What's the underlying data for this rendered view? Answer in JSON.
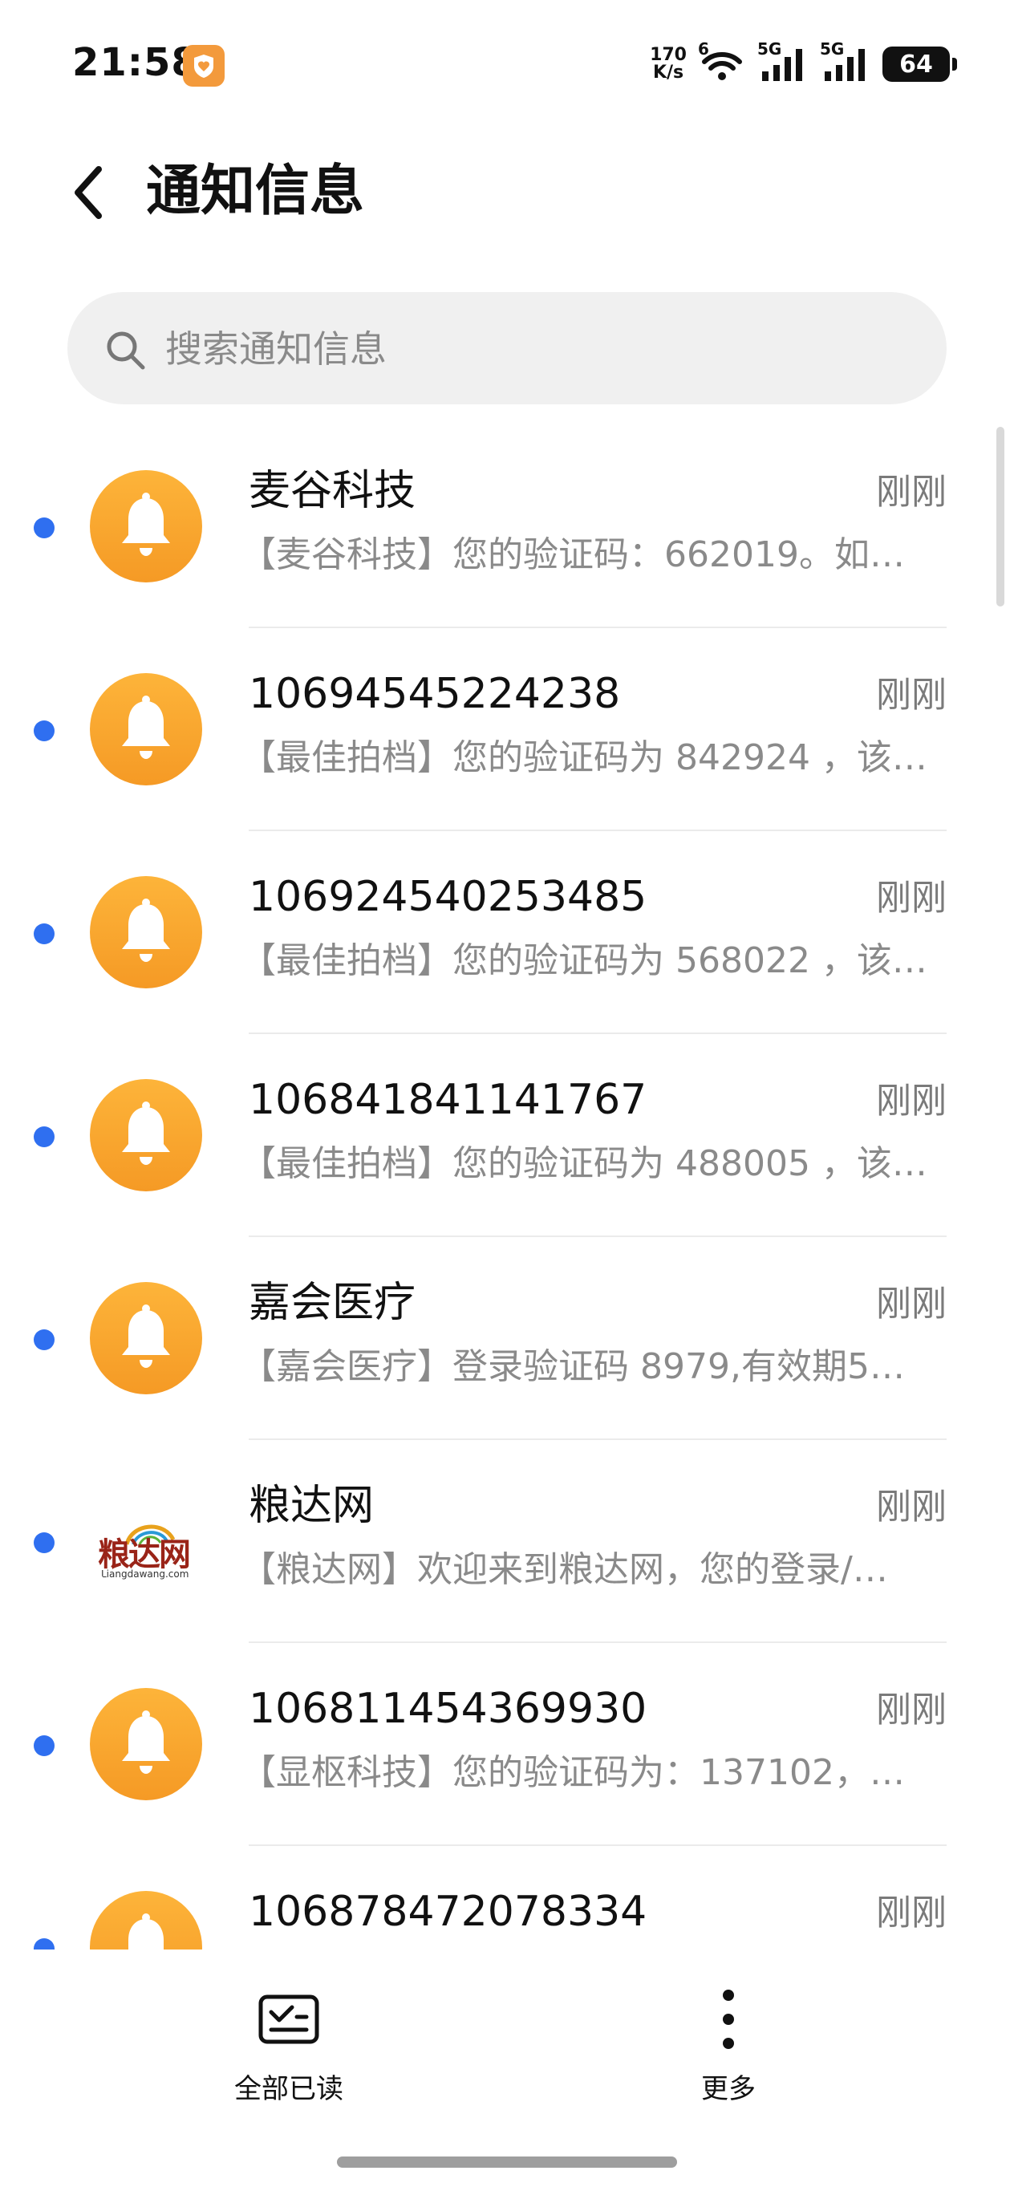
{
  "status_bar": {
    "time": "21:58",
    "net_speed_value": "170",
    "net_speed_unit": "K/s",
    "signal_1_label": "5G",
    "signal_2_label": "5G",
    "wifi_badge": "6",
    "battery": "64"
  },
  "header": {
    "title": "通知信息"
  },
  "search": {
    "placeholder": "搜索通知信息"
  },
  "messages": [
    {
      "sender": "麦谷科技",
      "time": "刚刚",
      "preview": "【麦谷科技】您的验证码：662019。如…",
      "avatar": "bell-icon",
      "unread": true
    },
    {
      "sender": "10694545224238",
      "time": "刚刚",
      "preview": "【最佳拍档】您的验证码为 842924 ，该…",
      "avatar": "bell-icon",
      "unread": true
    },
    {
      "sender": "106924540253485",
      "time": "刚刚",
      "preview": "【最佳拍档】您的验证码为 568022 ，该…",
      "avatar": "bell-icon",
      "unread": true
    },
    {
      "sender": "106841841141767",
      "time": "刚刚",
      "preview": "【最佳拍档】您的验证码为 488005 ，该…",
      "avatar": "bell-icon",
      "unread": true
    },
    {
      "sender": "嘉会医疗",
      "time": "刚刚",
      "preview": "【嘉会医疗】登录验证码 8979,有效期5…",
      "avatar": "bell-icon",
      "unread": true
    },
    {
      "sender": "粮达网",
      "time": "刚刚",
      "preview": "【粮达网】欢迎来到粮达网，您的登录/…",
      "avatar": "liangdawang-logo",
      "logo_text": "粮达网",
      "logo_sub": "Liangdawang.com",
      "unread": true
    },
    {
      "sender": "106811454369930",
      "time": "刚刚",
      "preview": "【显枢科技】您的验证码为：137102，…",
      "avatar": "bell-icon",
      "unread": true
    },
    {
      "sender": "106878472078334",
      "time": "刚刚",
      "preview": "",
      "avatar": "bell-icon",
      "unread": true
    }
  ],
  "bottom_bar": {
    "read_all_label": "全部已读",
    "more_label": "更多"
  },
  "colors": {
    "unread_dot": "#2f6ff0",
    "avatar_orange": "#f9a530",
    "secondary_text": "#8a8a8a"
  }
}
